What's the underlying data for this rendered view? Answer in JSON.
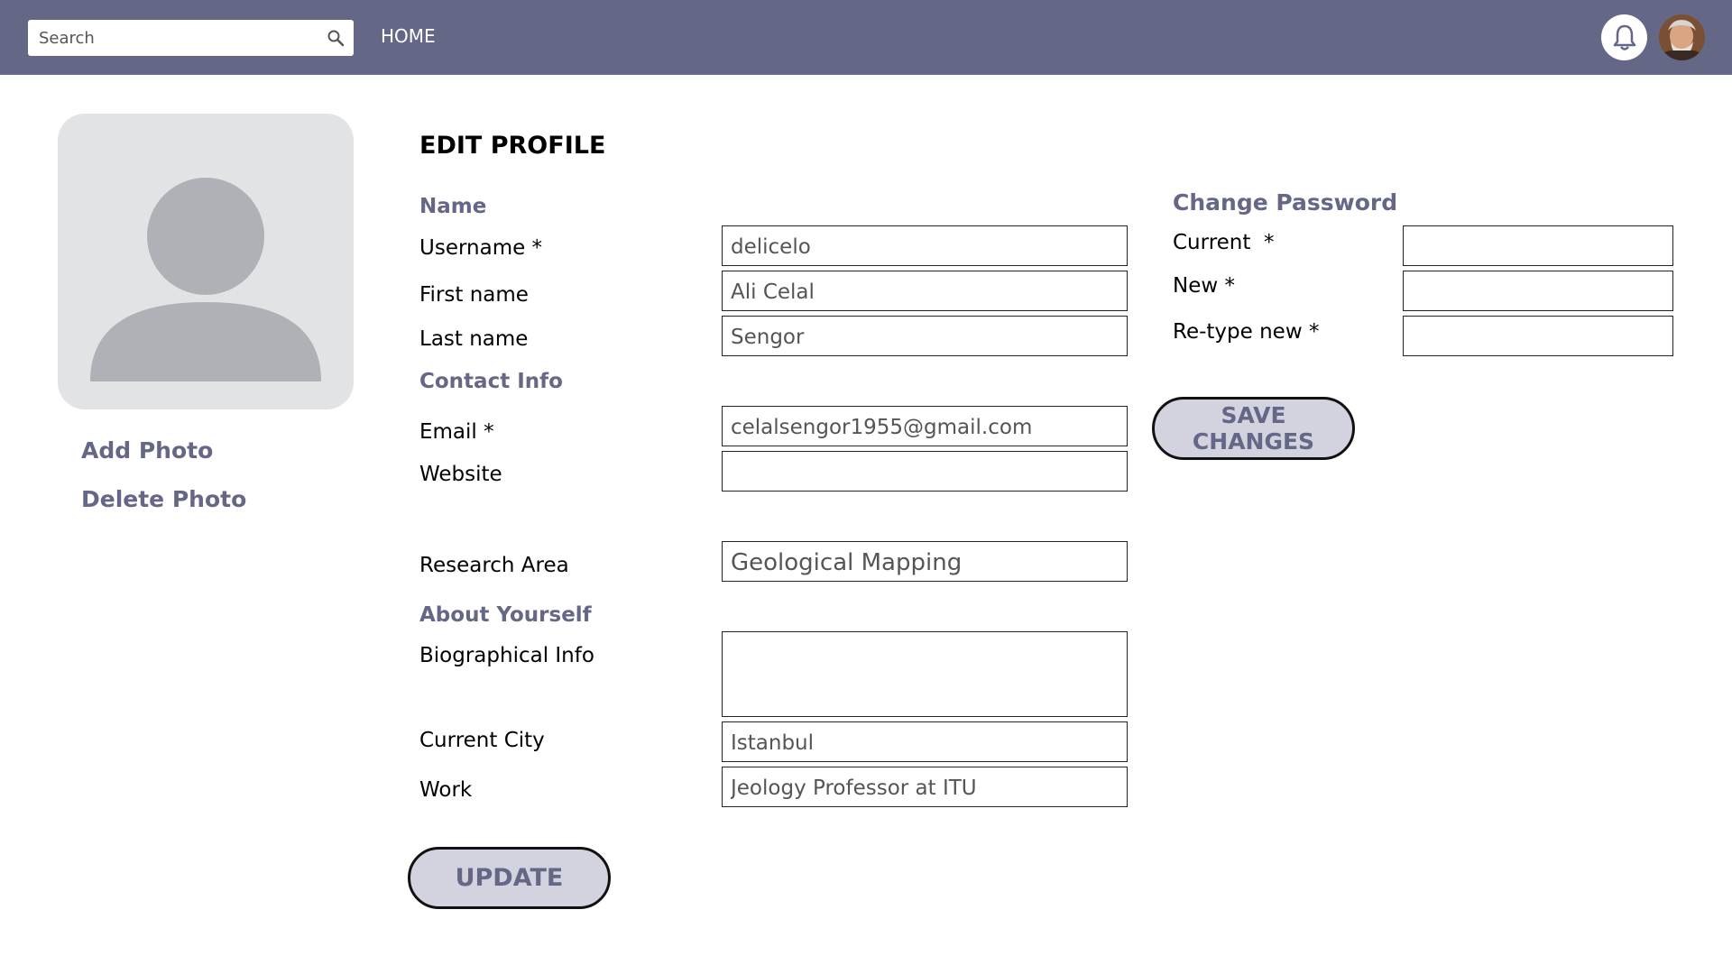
{
  "header": {
    "search_placeholder": "Search",
    "home_label": "HOME",
    "bell_icon": "bell-icon",
    "avatar_icon": "user-avatar"
  },
  "sidebar": {
    "add_photo": "Add Photo",
    "delete_photo": "Delete Photo"
  },
  "form": {
    "title": "EDIT PROFILE",
    "name_section": "Name",
    "username_label": "Username *",
    "username_value": "delicelo",
    "first_name_label": "First name",
    "first_name_value": "Ali Celal",
    "last_name_label": "Last name",
    "last_name_value": "Sengor",
    "contact_section": "Contact Info",
    "email_label": "Email *",
    "email_value": "celalsengor1955@gmail.com",
    "website_label": "Website",
    "website_value": "",
    "research_label": "Research Area",
    "research_value": "Geological Mapping",
    "about_section": "About Yourself",
    "bio_label": "Biographical Info",
    "bio_value": "",
    "city_label": "Current City",
    "city_value": "Istanbul",
    "work_label": "Work",
    "work_value": "Jeology Professor at ITU",
    "update_label": "UPDATE"
  },
  "password": {
    "section": "Change Password",
    "current_label": "Current  *",
    "new_label": "New *",
    "retype_label": "Re-type new *",
    "save_label": "SAVE CHANGES"
  },
  "colors": {
    "header_bg": "#646786",
    "accent": "#646786",
    "button_bg": "#d2d3de",
    "placeholder_bg": "#e2e3e5",
    "silhouette": "#aeb2b6"
  }
}
